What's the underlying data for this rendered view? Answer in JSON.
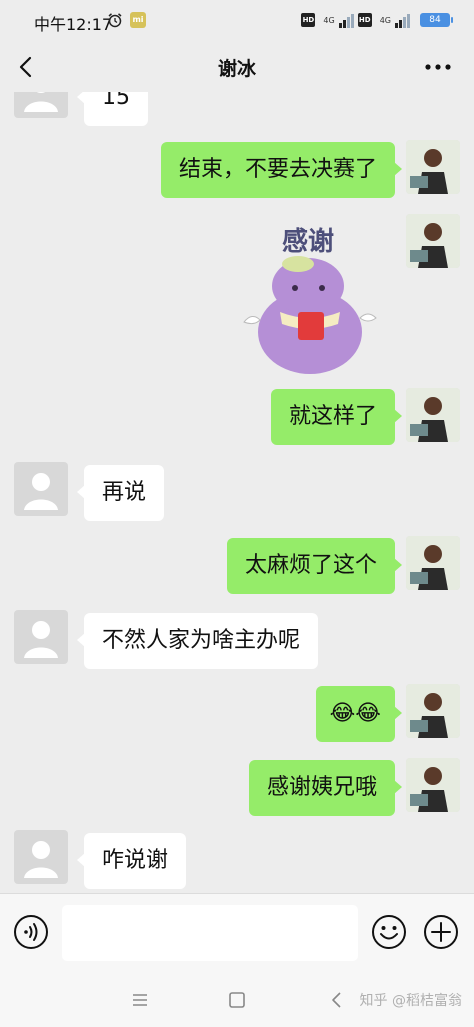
{
  "status_bar": {
    "time": "中午12:17",
    "alarm_icon": "alarm-clock-icon",
    "mi_icon": "mi-app-icon",
    "hd_badge": "HD",
    "network": "4G",
    "battery": "84"
  },
  "header": {
    "title": "谢冰",
    "back_icon": "chevron-left-icon",
    "more_icon": "more-dots-icon"
  },
  "messages": [
    {
      "side": "in",
      "type": "text",
      "text": "15"
    },
    {
      "side": "out",
      "type": "text",
      "text": "结束，不要去决赛了"
    },
    {
      "side": "out",
      "type": "sticker",
      "text": "感谢"
    },
    {
      "side": "out",
      "type": "text",
      "text": "就这样了"
    },
    {
      "side": "in",
      "type": "text",
      "text": "再说"
    },
    {
      "side": "out",
      "type": "text",
      "text": "太麻烦了这个"
    },
    {
      "side": "in",
      "type": "text",
      "text": "不然人家为啥主办呢"
    },
    {
      "side": "out",
      "type": "emoji",
      "text": "😂😂"
    },
    {
      "side": "out",
      "type": "text",
      "text": "感谢姨兄哦"
    },
    {
      "side": "in",
      "type": "text",
      "text": "咋说谢"
    }
  ],
  "input_bar": {
    "voice_icon": "voice-icon",
    "input_value": "",
    "emoji_icon": "smiley-icon",
    "plus_icon": "plus-circle-icon"
  },
  "nav_bar": {
    "menu_icon": "menu-icon",
    "home_icon": "home-square-icon",
    "back_icon": "back-triangle-icon",
    "watermark": "知乎 @稻桔富翁"
  },
  "colors": {
    "background": "#ededed",
    "outgoing_bubble": "#95ec69",
    "incoming_bubble": "#ffffff"
  }
}
